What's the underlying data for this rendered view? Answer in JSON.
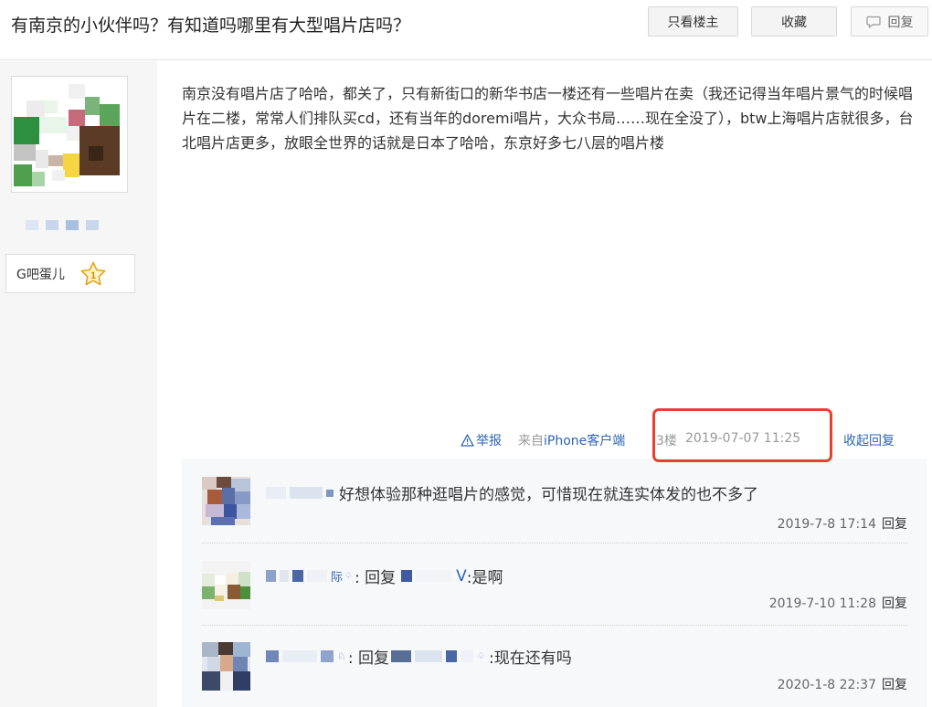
{
  "thread": {
    "title": "有南京的小伙伴吗？有知道吗哪里有大型唱片店吗？",
    "only_op_label": "只看楼主",
    "favorite_label": "收藏",
    "reply_label": "回复"
  },
  "author": {
    "badge_name": "G吧蛋儿",
    "badge_level": "1"
  },
  "post": {
    "content": "南京没有唱片店了哈哈，都关了，只有新街口的新华书店一楼还有一些唱片在卖（我还记得当年唱片景气的时候唱片在二楼，常常人们排队买cd，还有当年的doremi唱片，大众书局……现在全没了），btw上海唱片店就很多，台北唱片店更多，放眼全世界的话就是日本了哈哈，东京好多七八层的唱片楼",
    "report_label": "举报",
    "source_prefix": "来自",
    "source_client": "iPhone客户端",
    "floor": "3楼",
    "time": "2019-07-07 11:25",
    "collapse_label": "收起回复"
  },
  "replies": [
    {
      "text": "好想体验那种逛唱片的感觉，可惜现在就连实体发的也不多了",
      "time": "2019-7-8 17:14",
      "reply_label": "回复"
    },
    {
      "name_tail": "际",
      "colon_reply": ": 回复",
      "target_tail": "V",
      "text": ":是啊",
      "time": "2019-7-10 11:28",
      "reply_label": "回复"
    },
    {
      "colon_reply": ": 回复",
      "text": ":现在还有吗",
      "time": "2020-1-8 22:37",
      "reply_label": "回复"
    }
  ],
  "colors": {
    "link": "#2d64b3",
    "highlight": "#e8402e",
    "sidebar_bg": "#f6f6f6",
    "reply_bg": "#f7f8fa"
  }
}
